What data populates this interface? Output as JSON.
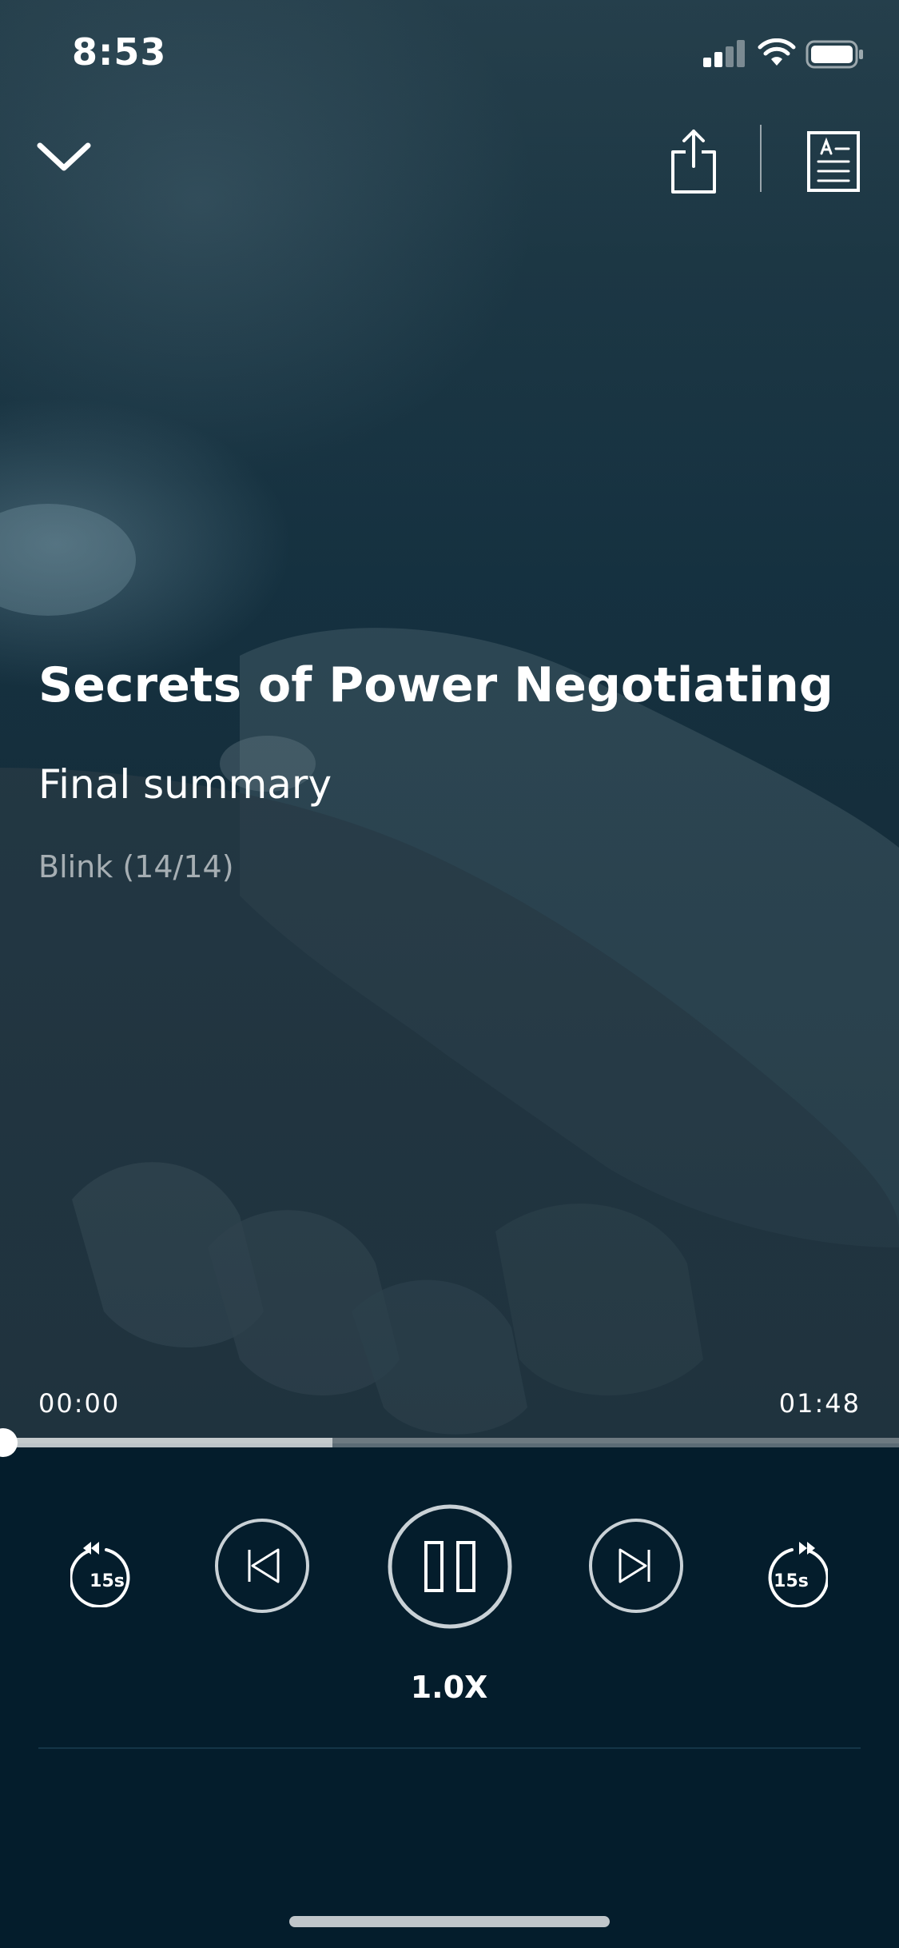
{
  "status_bar": {
    "time": "8:53",
    "icons": [
      "signal-icon",
      "wifi-icon",
      "battery-icon"
    ]
  },
  "nav": {
    "collapse_icon": "chevron-down-icon",
    "share_icon": "share-icon",
    "transcript_icon": "text-document-icon"
  },
  "content": {
    "book_title": "Secrets of Power Negotiating",
    "chapter_title": "Final summary",
    "blink_counter": "Blink (14/14)"
  },
  "player": {
    "elapsed": "00:00",
    "total": "01:48",
    "progress_fraction": 0.0,
    "buffered_fraction": 0.37,
    "rewind_label": "15s",
    "forward_label": "15s",
    "speed_label": "1.0X",
    "state": "playing"
  },
  "colors": {
    "background": "#041d2c",
    "text_primary": "#ffffff",
    "control_stroke": "#c9d1d6"
  }
}
